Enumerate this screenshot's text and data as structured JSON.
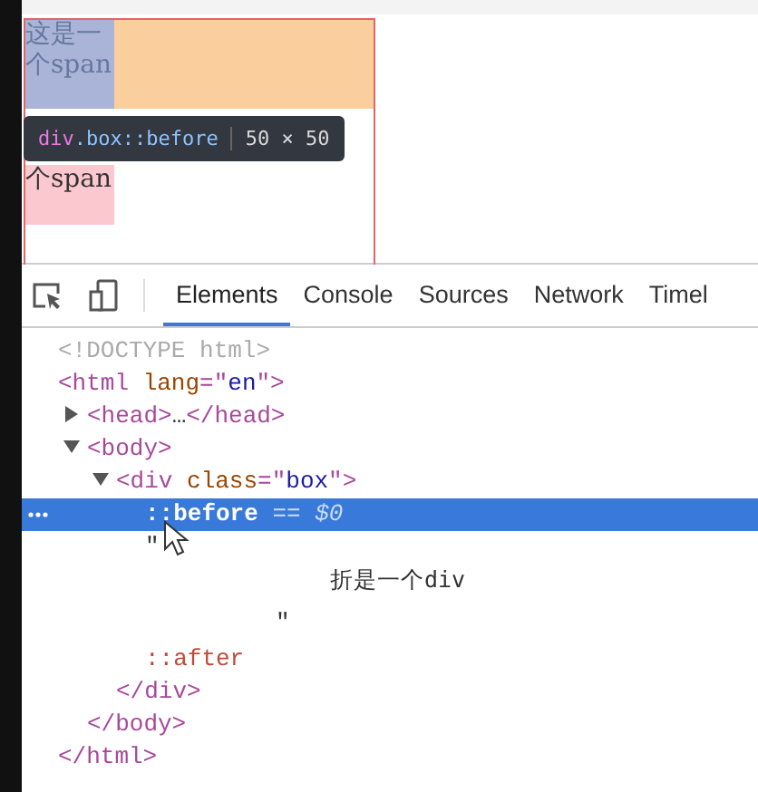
{
  "page": {
    "span_top": "这是一个span",
    "span_bottom": "个span"
  },
  "tooltip": {
    "tag": "div",
    "rest": ".box::before",
    "size": "50 × 50"
  },
  "toolbar": {
    "tabs": [
      {
        "label": "Elements",
        "selected": true
      },
      {
        "label": "Console",
        "selected": false
      },
      {
        "label": "Sources",
        "selected": false
      },
      {
        "label": "Network",
        "selected": false
      },
      {
        "label": "Timel",
        "selected": false
      }
    ]
  },
  "dom_tree": [
    {
      "kind": "doctype",
      "segs": [
        {
          "s": "<!DOCTYPE html>",
          "kind": "doctype"
        }
      ]
    },
    {
      "kind": "element",
      "segs": [
        {
          "s": "<html",
          "kind": "tag"
        },
        {
          "s": " lang",
          "kind": "attr"
        },
        {
          "s": "=\"",
          "kind": "tag"
        },
        {
          "s": "en",
          "kind": "value"
        },
        {
          "s": "\">",
          "kind": "tag"
        }
      ],
      "close": "</html>",
      "children": [
        {
          "kind": "element",
          "expanded": false,
          "segs": [
            {
              "s": "<head>",
              "kind": "tag"
            },
            {
              "s": "…",
              "kind": "text"
            },
            {
              "s": "</head>",
              "kind": "tag"
            }
          ]
        },
        {
          "kind": "element",
          "expanded": true,
          "segs": [
            {
              "s": "<body>",
              "kind": "tag"
            }
          ],
          "close": "</body>",
          "children": [
            {
              "kind": "element",
              "expanded": true,
              "segs": [
                {
                  "s": "<div",
                  "kind": "tag"
                },
                {
                  "s": " class",
                  "kind": "attr"
                },
                {
                  "s": "=\"",
                  "kind": "tag"
                },
                {
                  "s": "box",
                  "kind": "value"
                },
                {
                  "s": "\">",
                  "kind": "tag"
                }
              ],
              "close": "</div>",
              "children": [
                {
                  "kind": "pseudo",
                  "selected": true,
                  "segs": [
                    {
                      "s": "::before",
                      "kind": "pseudo"
                    },
                    {
                      "s": " == $0",
                      "kind": "ref"
                    }
                  ]
                },
                {
                  "kind": "text",
                  "segs": [
                    {
                      "s": "\""
                    },
                    {
                      "s": "折是一个div"
                    },
                    {
                      "s": "\""
                    }
                  ]
                },
                {
                  "kind": "pseudo",
                  "selected": false,
                  "segs": [
                    {
                      "s": "::after",
                      "kind": "pseudo"
                    }
                  ]
                }
              ]
            }
          ]
        }
      ]
    }
  ]
}
